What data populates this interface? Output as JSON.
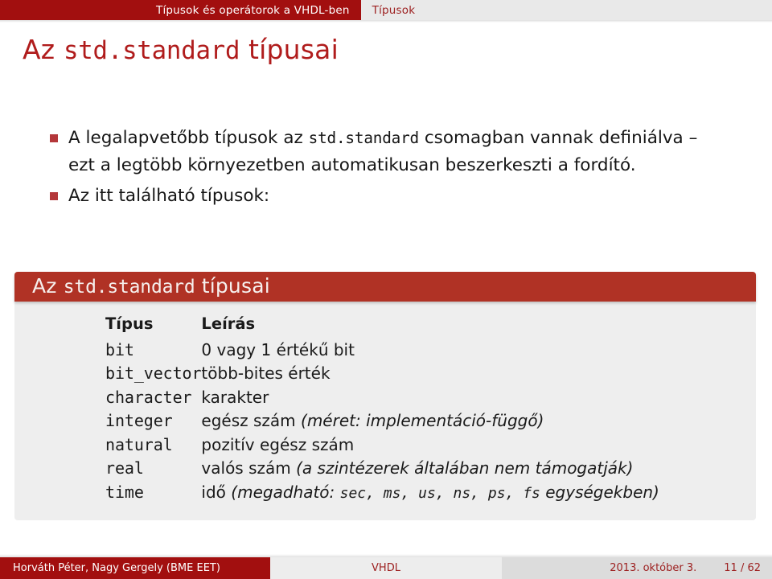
{
  "header": {
    "section_active": "Típusok és operátorok a VHDL-ben",
    "subsection_inactive": "Típusok"
  },
  "frame": {
    "title_pre": "Az ",
    "title_mono": "std.standard",
    "title_post": " típusai"
  },
  "bullets": [
    {
      "marker": "square-bullet",
      "part1": "A legalapvetőbb típusok az ",
      "mono": "std.standard",
      "part2": " csomagban vannak definiálva – ezt a legtöbb környezetben automatikusan beszerkeszti a fordító."
    },
    {
      "marker": "square-bullet",
      "part1": "Az itt található típusok:",
      "mono": "",
      "part2": ""
    }
  ],
  "block": {
    "title_pre": "Az ",
    "title_mono": "std.standard",
    "title_post": " típusai",
    "columns": [
      "Típus",
      "Leírás"
    ],
    "rows": [
      {
        "type": "bit",
        "desc_plain": "0 vagy 1 értékű bit",
        "desc_italic": "",
        "desc_tail": ""
      },
      {
        "type": "bit_vector",
        "desc_plain": "több-bites érték",
        "desc_italic": "",
        "desc_tail": ""
      },
      {
        "type": "character",
        "desc_plain": "karakter",
        "desc_italic": "",
        "desc_tail": ""
      },
      {
        "type": "integer",
        "desc_plain": "egész szám ",
        "desc_italic": "(méret: implementáció-függő)",
        "desc_tail": ""
      },
      {
        "type": "natural",
        "desc_plain": "pozitív egész szám",
        "desc_italic": "",
        "desc_tail": ""
      },
      {
        "type": "real",
        "desc_plain": "valós szám ",
        "desc_italic": "(a szintézerek általában nem támogatják)",
        "desc_tail": ""
      },
      {
        "type": "time",
        "desc_plain": "idő ",
        "desc_italic": "(megadható: ",
        "desc_units": "sec, ms, us, ns, ps, fs",
        "desc_tail": " egységekben)"
      }
    ]
  },
  "footer": {
    "authors": "Horváth Péter, Nagy Gergely  (BME EET)",
    "title": "VHDL",
    "date": "2013. október 3.",
    "page": "11 / 62"
  },
  "colors": {
    "brand_dark_red": "#a20f0f",
    "brand_block_red": "#b03225",
    "title_red": "#b01c1c",
    "bullet_red": "#b4373a",
    "block_body_gray": "#eeeeee",
    "footer_gray": "#dcdcdc"
  }
}
